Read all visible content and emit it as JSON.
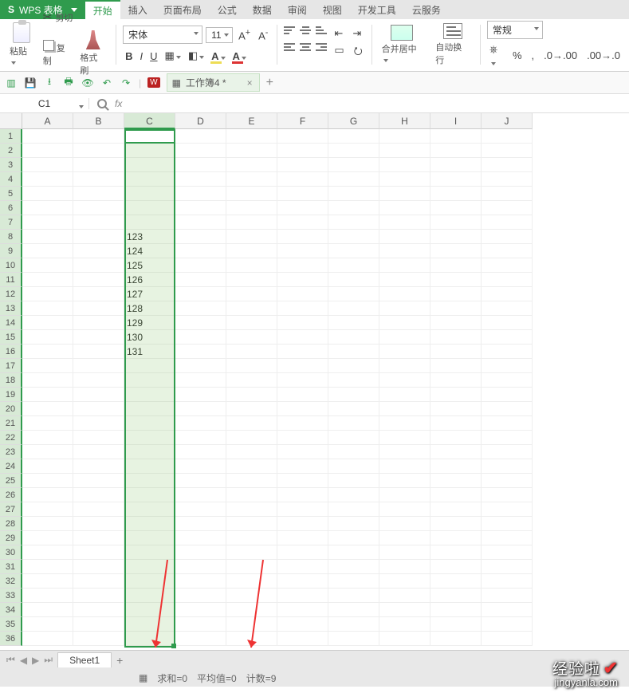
{
  "app": {
    "name": "WPS 表格"
  },
  "menus": [
    "开始",
    "插入",
    "页面布局",
    "公式",
    "数据",
    "审阅",
    "视图",
    "开发工具",
    "云服务"
  ],
  "active_menu": 0,
  "clipboard": {
    "paste": "粘贴",
    "cut": "剪切",
    "copy": "复制",
    "formatPainter": "格式刷"
  },
  "font": {
    "name": "宋体",
    "size": "11",
    "bold": "B",
    "italic": "I",
    "underline": "U",
    "grow": "A⁺",
    "shrink": "A⁻",
    "colorA": "A"
  },
  "merge_label": "合并居中",
  "wrap_label": "自动换行",
  "number_format": "常规",
  "doc_tab": "工作簿4 *",
  "name_box": "C1",
  "fx_label": "fx",
  "columns": [
    "A",
    "B",
    "C",
    "D",
    "E",
    "F",
    "G",
    "H",
    "I",
    "J"
  ],
  "selected_column": 2,
  "row_count": 36,
  "column_c_values": {
    "8": "123",
    "9": "124",
    "10": "125",
    "11": "126",
    "12": "127",
    "13": "128",
    "14": "129",
    "15": "130",
    "16": "131"
  },
  "sheet_tab": "Sheet1",
  "status": {
    "sum": "求和=0",
    "avg": "平均值=0",
    "count": "计数=9"
  },
  "watermark": {
    "line1": "经验啦",
    "line2": "jingyanla.com"
  },
  "chart_data": {
    "type": "table",
    "title": "",
    "columns": [
      "C"
    ],
    "rows": [
      {
        "row": 8,
        "C": 123
      },
      {
        "row": 9,
        "C": 124
      },
      {
        "row": 10,
        "C": 125
      },
      {
        "row": 11,
        "C": 126
      },
      {
        "row": 12,
        "C": 127
      },
      {
        "row": 13,
        "C": 128
      },
      {
        "row": 14,
        "C": 129
      },
      {
        "row": 15,
        "C": 130
      },
      {
        "row": 16,
        "C": 131
      }
    ]
  }
}
